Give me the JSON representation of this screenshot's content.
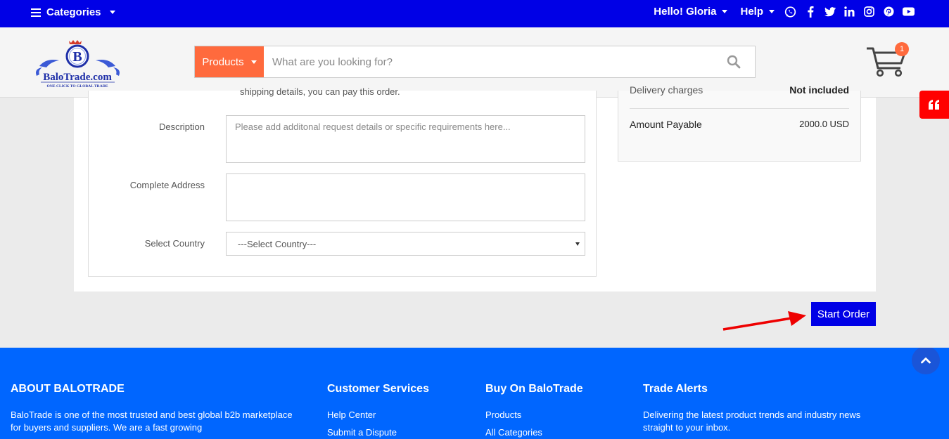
{
  "topbar": {
    "categories_label": "Categories",
    "greeting": "Hello! Gloria",
    "help_label": "Help",
    "social_icons": [
      "whatsapp-icon",
      "facebook-icon",
      "twitter-icon",
      "linkedin-icon",
      "instagram-icon",
      "pinterest-icon",
      "youtube-icon"
    ]
  },
  "header": {
    "logo_brand": "BaloTrade.com",
    "logo_tagline": "ONE CLICK TO GLOBAL TRADE",
    "logo_letter": "B",
    "search_category": "Products",
    "search_placeholder": "What are you looking for?",
    "cart_count": "1"
  },
  "form": {
    "cut_text": "shipping details, you can pay this order.",
    "description_label": "Description",
    "description_placeholder": "Please add additonal request details or specific requirements here...",
    "address_label": "Complete Address",
    "address_value": "",
    "country_label": "Select Country",
    "country_selected": "---Select Country---"
  },
  "summary": {
    "delivery_label": "Delivery charges",
    "delivery_value": "Not included",
    "payable_label": "Amount Payable",
    "payable_value": "2000.0 USD"
  },
  "actions": {
    "start_order_label": "Start Order"
  },
  "footer": {
    "about_title": "ABOUT BALOTRADE",
    "about_text": "BaloTrade is one of the most trusted and best global b2b marketplace for buyers and suppliers. We are a fast growing",
    "customer_title": "Customer Services",
    "customer_links": [
      "Help Center",
      "Submit a Dispute"
    ],
    "buy_title": "Buy On BaloTrade",
    "buy_links": [
      "Products",
      "All Categories"
    ],
    "alerts_title": "Trade Alerts",
    "alerts_text": "Delivering the latest product trends and industry news straight to your inbox."
  },
  "colors": {
    "topbar": "#0000e6",
    "accent": "#ff6a3d",
    "footer": "#0066ff",
    "quote_tab": "#ff0000",
    "annotation_arrow": "#ee0000"
  }
}
